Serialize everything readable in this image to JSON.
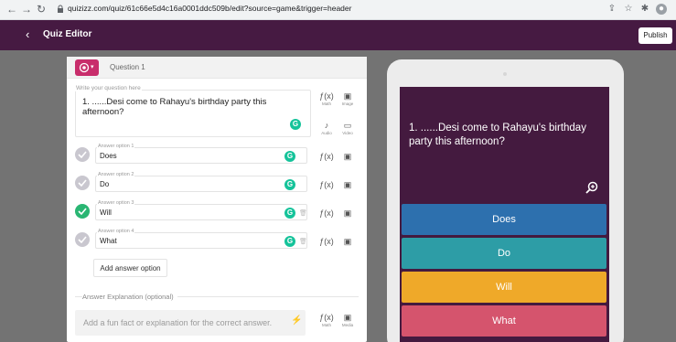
{
  "browser": {
    "url": "quizizz.com/quiz/61c66e5d4c16a0001ddc509b/edit?source=game&trigger=header"
  },
  "header": {
    "title": "Quiz Editor",
    "publish_label": "Publish"
  },
  "editor": {
    "question_label": "Question 1",
    "question_caption": "Write your question here",
    "question_text": "1.   ......Desi come to Rahayu's birthday party this afternoon?",
    "tools": {
      "math": "Math",
      "image": "Image",
      "audio": "Audio",
      "video": "Video",
      "media": "Media"
    },
    "answers": [
      {
        "caption": "Answer option 1",
        "text": "Does",
        "correct": false
      },
      {
        "caption": "Answer option 2",
        "text": "Do",
        "correct": false
      },
      {
        "caption": "Answer option 3",
        "text": "Will",
        "correct": true
      },
      {
        "caption": "Answer option 4",
        "text": "What",
        "correct": false
      }
    ],
    "add_answer_label": "Add answer option",
    "explanation_label": "Answer Explanation (optional)",
    "explanation_placeholder": "Add a fun fact or explanation for the correct answer."
  },
  "preview": {
    "question_text": "1.     ......Desi come to Rahayu's birthday party this afternoon?",
    "options": [
      {
        "text": "Does",
        "color": "#2d70ae"
      },
      {
        "text": "Do",
        "color": "#2d9da6"
      },
      {
        "text": "Will",
        "color": "#efa929"
      },
      {
        "text": "What",
        "color": "#d5546d"
      }
    ]
  },
  "icons": [
    "back-arrow-icon",
    "forward-arrow-icon",
    "reload-icon",
    "lock-icon",
    "share-icon",
    "star-icon",
    "extensions-icon",
    "profile-icon",
    "chevron-left-icon",
    "question-type-icon",
    "grammarly-icon",
    "math-icon",
    "image-icon",
    "audio-icon",
    "video-icon",
    "checkmark-icon",
    "trash-icon",
    "bolt-icon",
    "zoom-icon"
  ],
  "colors": {
    "header_bg": "#461a42",
    "accent": "#c82d6b",
    "correct": "#2ab673",
    "preview_bg": "#441a3f"
  }
}
